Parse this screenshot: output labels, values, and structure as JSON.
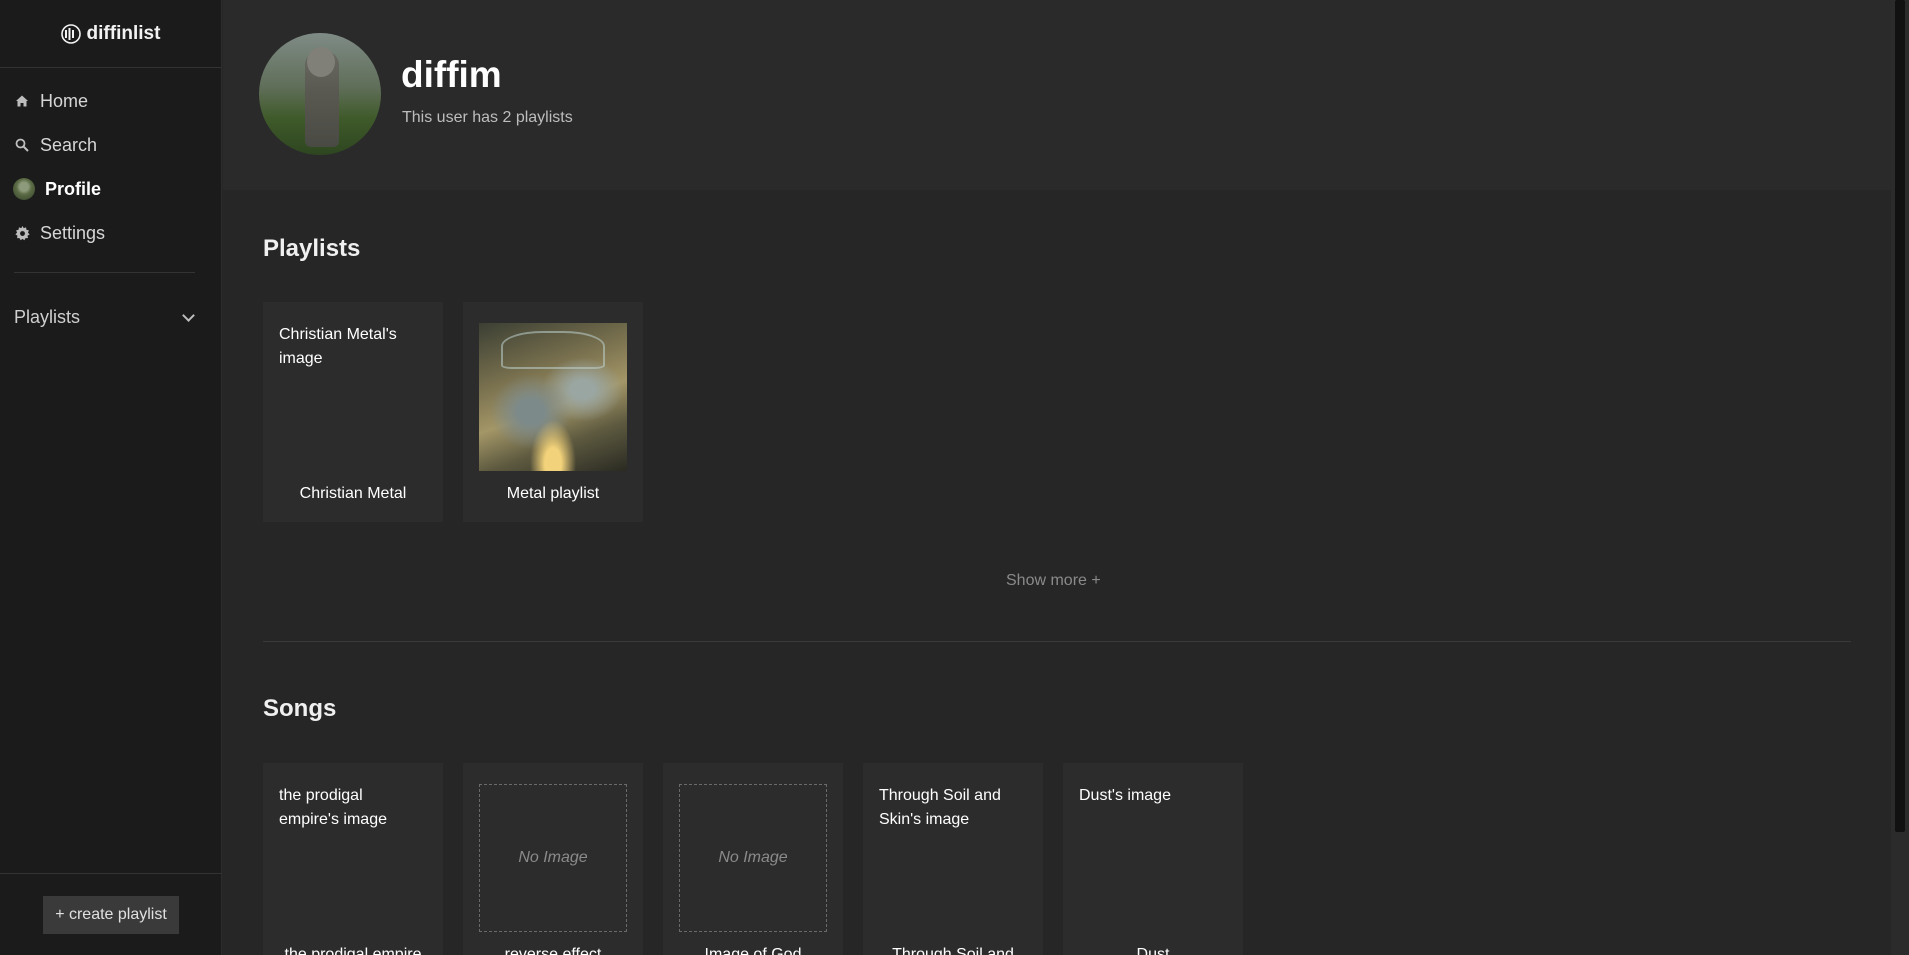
{
  "app": {
    "brand": "diffinlist"
  },
  "sidebar": {
    "nav": [
      {
        "label": "Home",
        "icon": "home-icon"
      },
      {
        "label": "Search",
        "icon": "search-icon"
      },
      {
        "label": "Profile",
        "icon": "avatar"
      },
      {
        "label": "Settings",
        "icon": "gear-icon"
      }
    ],
    "playlists_label": "Playlists",
    "create_label": "+ create playlist"
  },
  "profile": {
    "name": "diffim",
    "subtitle": "This user has 2 playlists"
  },
  "playlists": {
    "title": "Playlists",
    "items": [
      {
        "title": "Christian Metal",
        "image_alt": "Christian Metal's image"
      },
      {
        "title": "Metal playlist",
        "image_alt": ""
      }
    ],
    "show_more": "Show more +"
  },
  "songs": {
    "title": "Songs",
    "items": [
      {
        "title": "the prodigal empire",
        "image_alt": "the prodigal empire's image"
      },
      {
        "title": "reverse effect",
        "placeholder": "No Image"
      },
      {
        "title": "Image of God",
        "placeholder": "No Image"
      },
      {
        "title": "Through Soil and",
        "image_alt": "Through Soil and Skin's image"
      },
      {
        "title": "Dust",
        "image_alt": "Dust's image"
      }
    ]
  }
}
